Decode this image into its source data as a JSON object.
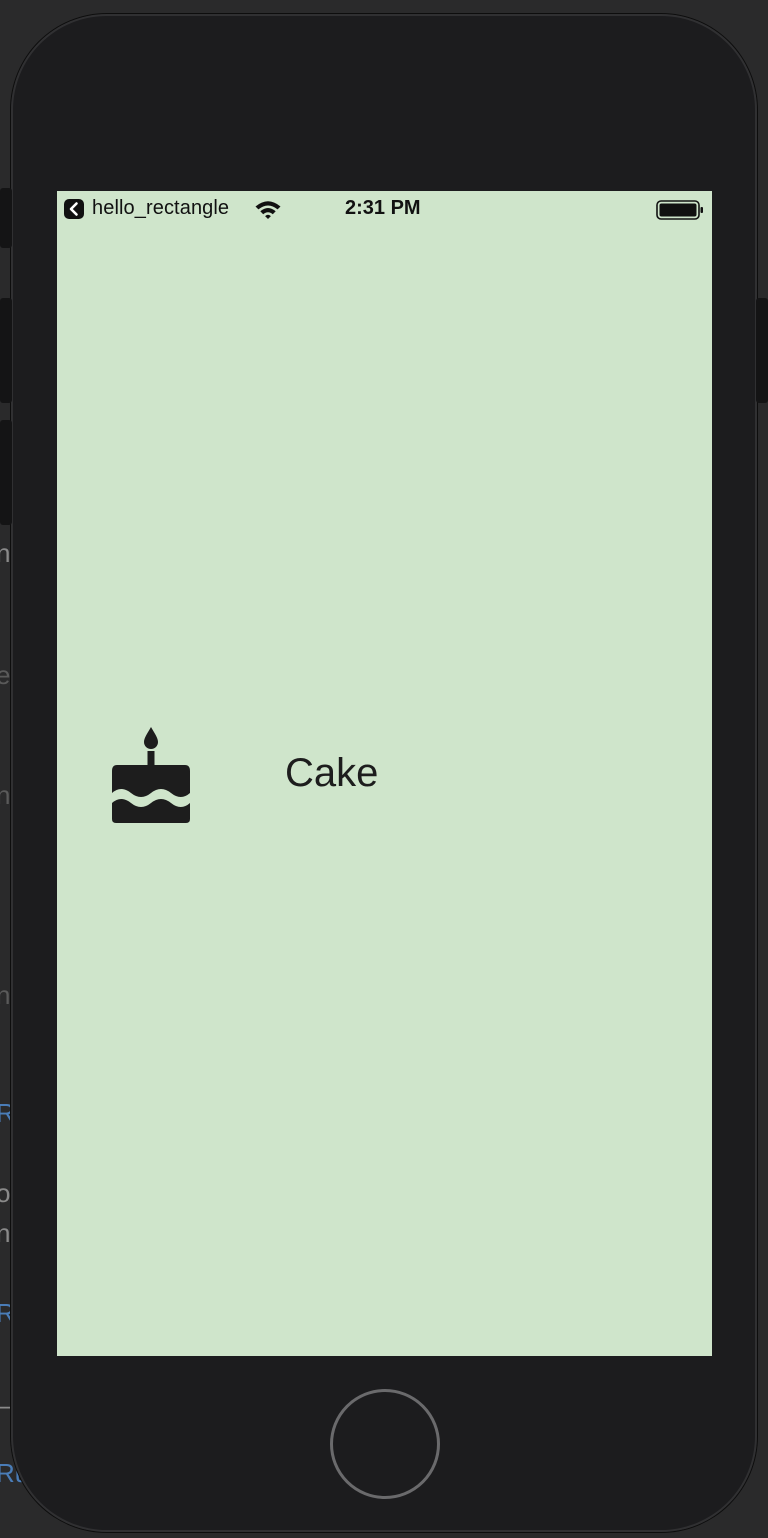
{
  "status_bar": {
    "back_app_name": "hello_rectangle",
    "time": "2:31 PM",
    "icons": [
      "back-chevron-icon",
      "wifi-icon",
      "battery-icon"
    ]
  },
  "content": {
    "row": {
      "icon": "cake-icon",
      "label": "Cake"
    },
    "background_color": "#cfe5cb"
  },
  "device": {
    "home_button": "home-button"
  },
  "backdrop_edge_text": [
    "n",
    "e",
    "n",
    "n",
    "R",
    "o",
    "n",
    "R",
    "–",
    "Ru"
  ]
}
